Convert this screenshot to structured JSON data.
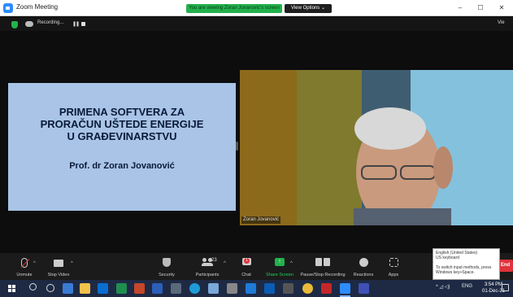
{
  "window": {
    "title": "Zoom Meeting"
  },
  "banner": {
    "viewing_text": "You are viewing Zoran Jovanovic's screen",
    "view_options": "View Options ⌄"
  },
  "window_controls": {
    "minimize": "–",
    "maximize": "☐",
    "close": "✕"
  },
  "recording": {
    "label": "Recording...",
    "pause": "❚❚",
    "view_right": "Vie"
  },
  "slide": {
    "title_lines": [
      "PRIMENA SOFTVERA ZA",
      "PRORAČUN UŠTEDE ENERGIJE",
      "U GRAĐEVINARSTVU"
    ],
    "author": "Prof. dr Zoran Jovanović"
  },
  "video": {
    "participant_name": "Zoran Jovanović"
  },
  "toolbar": {
    "unmute": "Unmute",
    "stop_video": "Stop Video",
    "security": "Security",
    "participants": "Participants",
    "participants_count": "23",
    "chat": "Chat",
    "chat_badge": "1",
    "share_screen": "Share Screen",
    "pause_stop_recording": "Pause/Stop Recording",
    "reactions": "Reactions",
    "apps": "Apps",
    "end": "End",
    "caret": "^"
  },
  "ime_tooltip": {
    "line1": "English (United States)",
    "line2": "US keyboard",
    "line3": "To switch input methods, press",
    "line4": "Windows key+Space."
  },
  "taskbar": {
    "language": "ENG",
    "time": "3:54 PM",
    "date": "01-Dec-21",
    "tray_icons": "^ ◿ ◁)"
  },
  "colors": {
    "accent_green": "#23b14d",
    "end_red": "#e0333a",
    "slide_bg": "#a9c4e6",
    "taskbar": "#1e2a44"
  }
}
